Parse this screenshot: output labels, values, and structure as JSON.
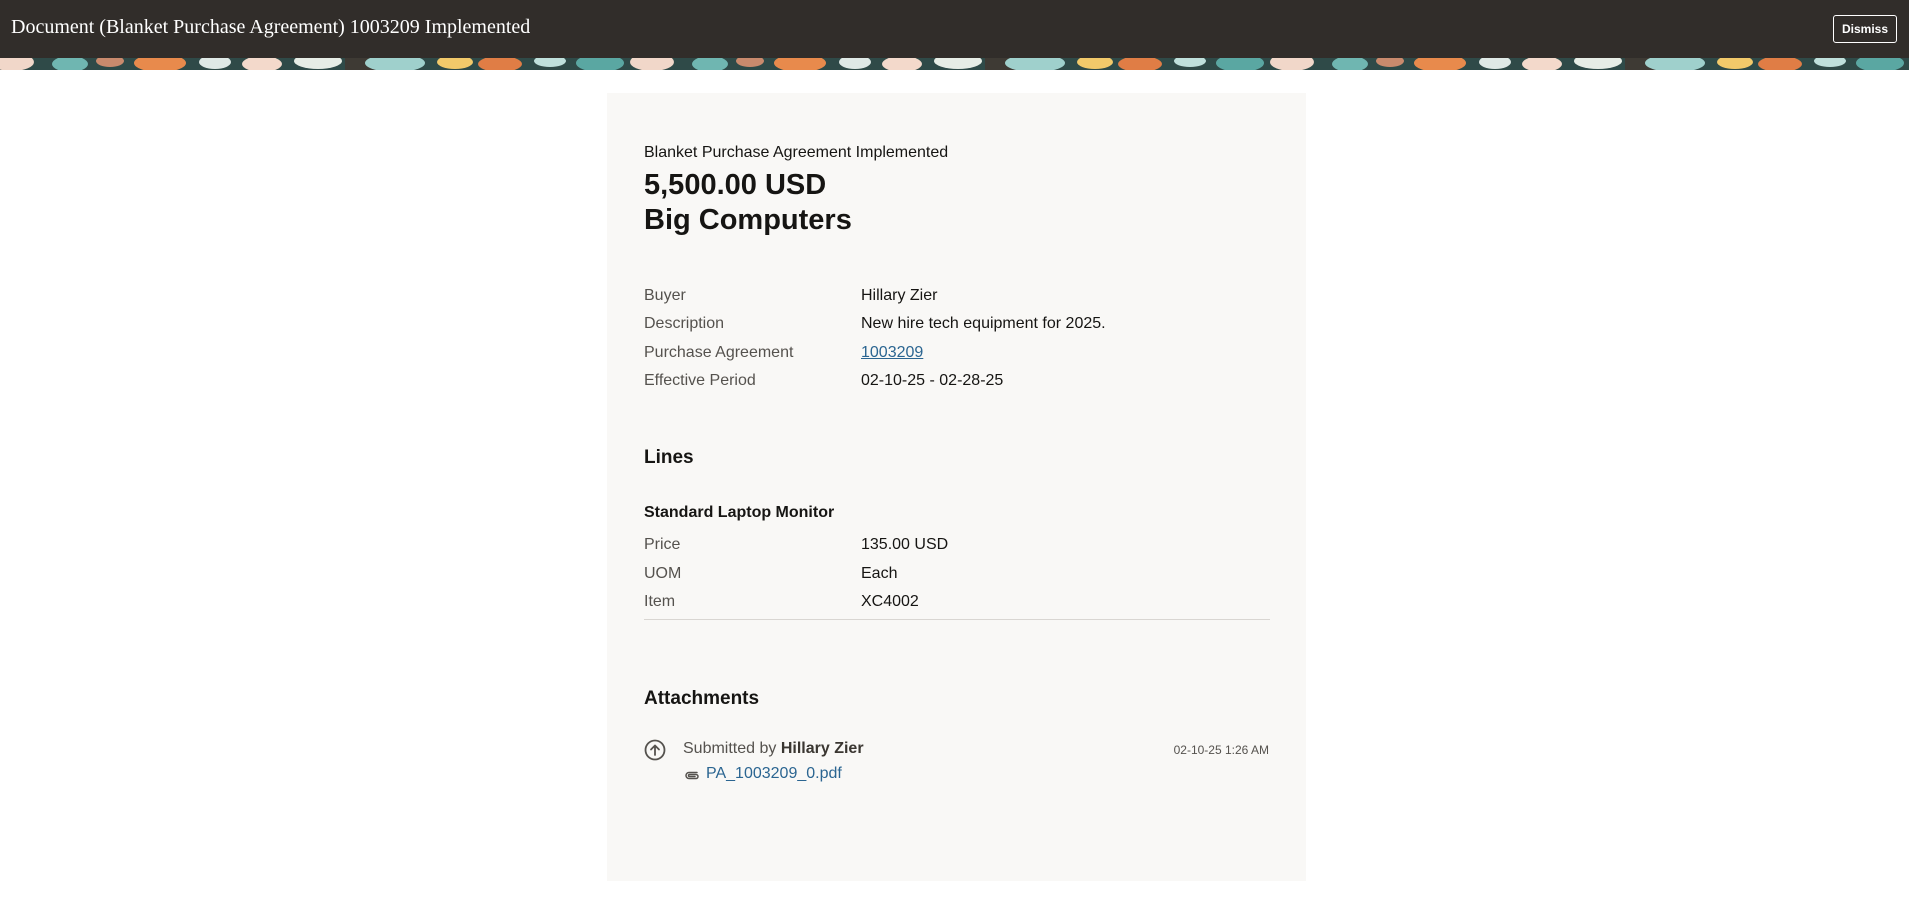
{
  "header": {
    "title": "Document (Blanket Purchase Agreement) 1003209 Implemented",
    "dismiss_label": "Dismiss"
  },
  "summary": {
    "status_text": "Blanket Purchase Agreement Implemented",
    "amount": "5,500.00 USD",
    "supplier": "Big Computers"
  },
  "details": {
    "buyer_label": "Buyer",
    "buyer_value": "Hillary Zier",
    "description_label": "Description",
    "description_value": "New hire tech equipment for 2025.",
    "agreement_label": "Purchase Agreement",
    "agreement_value": "1003209",
    "period_label": "Effective Period",
    "period_value": "02-10-25 - 02-28-25"
  },
  "lines": {
    "heading": "Lines",
    "item_name": "Standard Laptop Monitor",
    "price_label": "Price",
    "price_value": "135.00 USD",
    "uom_label": "UOM",
    "uom_value": "Each",
    "item_label": "Item",
    "item_value": "XC4002"
  },
  "attachments": {
    "heading": "Attachments",
    "submitted_prefix": "Submitted by",
    "submitted_by": "Hillary Zier",
    "timestamp": "02-10-25 1:26 AM",
    "file_name": "PA_1003209_0.pdf"
  },
  "icons": {
    "submit": "upload-circle-icon",
    "attachment": "paperclip-icon"
  },
  "colors": {
    "header_bg": "#312d2a",
    "link": "#2b6591",
    "card_bg": "#f9f8f6"
  }
}
